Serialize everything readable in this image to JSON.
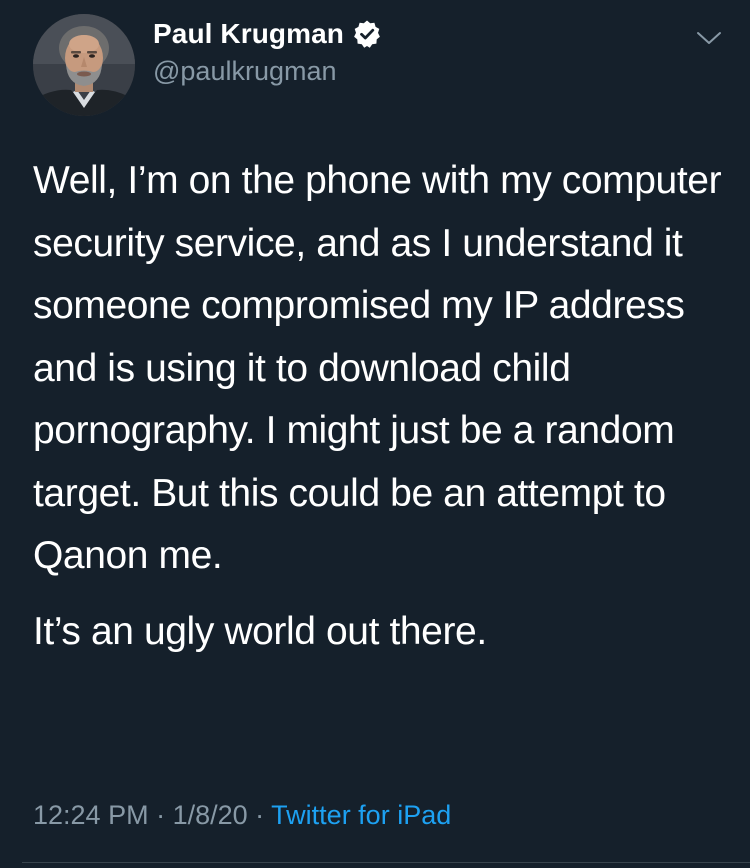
{
  "author": {
    "display_name": "Paul Krugman",
    "handle": "@paulkrugman",
    "verified": true
  },
  "tweet": {
    "paragraphs": [
      "Well, I’m on the phone with my computer security service, and as I understand it someone compromised my IP address and is using it to download child pornography. I might just be a random target. But this could be an attempt to Qanon me.",
      "It’s an ugly world out there."
    ],
    "time": "12:24 PM",
    "date": "1/8/20",
    "separator": " · ",
    "source": "Twitter for iPad"
  },
  "icons": {
    "verified": "verified-badge-icon",
    "menu": "chevron-down-icon"
  },
  "colors": {
    "background": "#15202b",
    "text": "#ffffff",
    "secondary": "#8899a6",
    "link": "#1da1f2",
    "divider": "#38444d"
  }
}
